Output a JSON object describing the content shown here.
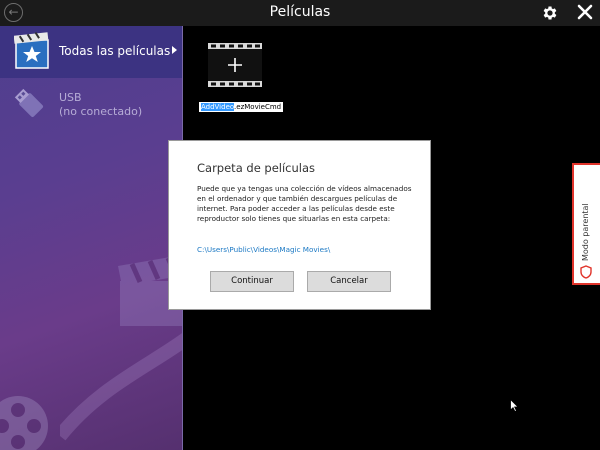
{
  "window": {
    "title": "Películas"
  },
  "sidebar": {
    "items": [
      {
        "label": "Todas las películas"
      },
      {
        "label": "USB",
        "sublabel": "(no conectado)"
      }
    ]
  },
  "main": {
    "tile": {
      "filename_selected": "AddVideo",
      "filename_rest": ".ezMovieCmd"
    }
  },
  "dialog": {
    "title": "Carpeta de películas",
    "body": "Puede que ya tengas una colección de vídeos almacenados en el ordenador y que también descargues películas de internet. Para poder acceder a las películas desde este reproductor solo tienes que situarlas en esta carpeta:",
    "path": "C:\\Users\\Public\\Videos\\Magic Movies\\",
    "continue_label": "Continuar",
    "cancel_label": "Cancelar"
  },
  "parental": {
    "label": "Modo parental"
  },
  "colors": {
    "accent": "#3c3382",
    "link": "#1c79c4",
    "parental_border": "#e0342b"
  }
}
